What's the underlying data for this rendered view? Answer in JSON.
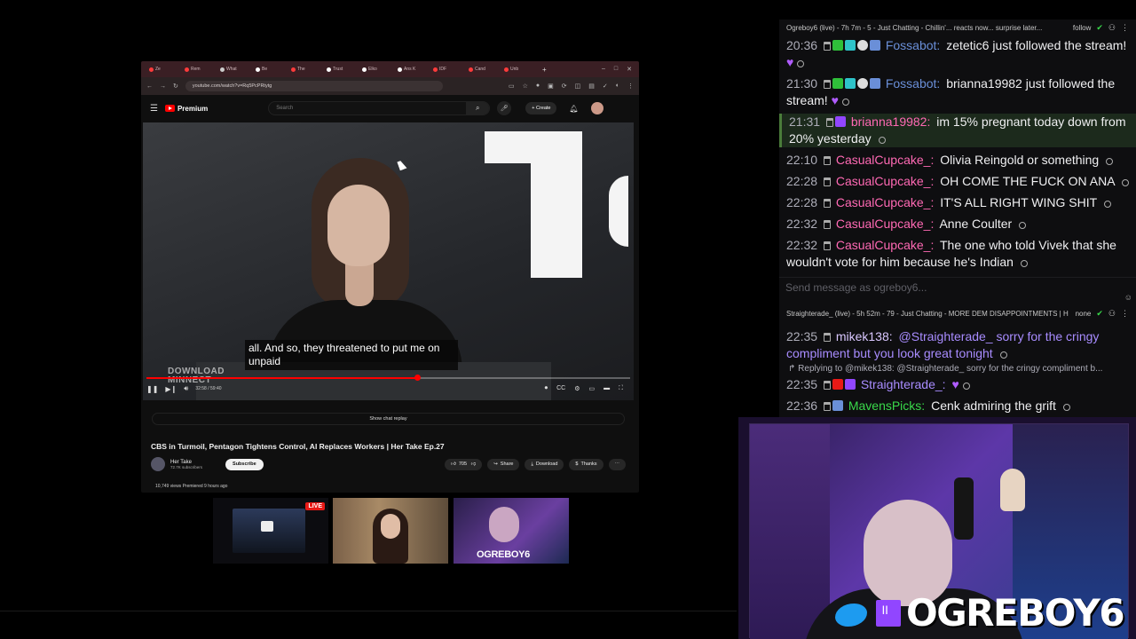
{
  "browser": {
    "tabs": [
      "Ze",
      "Rem",
      "What",
      "Be",
      "The",
      "Trust",
      "Elko",
      "Ans K",
      "IDF",
      "Cand",
      "Unb"
    ],
    "tab_colors": [
      "#ff3b3b",
      "#ff3b3b",
      "#cccccc",
      "#cccccc",
      "#ffffff",
      "#ff3b3b",
      "#ffffff",
      "#ffffff",
      "#ffffff",
      "#ff3b3b",
      "#ff3b3b",
      "#ff3b3b"
    ],
    "url": "youtube.com/watch?v=Rq5PcPRtytg"
  },
  "youtube": {
    "brand": "Premium",
    "search_placeholder": "Search",
    "create_label": "Create",
    "caption": "all. And so, they threatened to put me on unpaid",
    "watermark": "DOWNLOAD\nMINNECT",
    "timecode": "32:58 / 59:40",
    "progress_fraction": 0.56,
    "chat_replay": "Show chat replay",
    "title": "CBS in Turmoil, Pentagon Tightens Control, AI Replaces Workers | Her Take Ep.27",
    "channel_name": "Her Take",
    "channel_subs": "72.7K subscribers",
    "subscribe": "Subscribe",
    "likes": "705",
    "share": "Share",
    "download": "Download",
    "thanks": "Thanks",
    "meta": "10,749 views  Premiered 9 hours ago"
  },
  "thumbnails": {
    "live": "LIVE",
    "label3": "OGREBOY6"
  },
  "chat1": {
    "header": "Ogreboy6 (live) - 7h 7m - 5 - Just Chatting - Chillin'... reacts now... surprise later...",
    "follow": "follow",
    "messages": [
      {
        "time": "20:36",
        "user": "Fossabot:",
        "color": "#6a8fd8",
        "text": " zetetic6 just followed the stream!"
      },
      {
        "time": "21:30",
        "user": "Fossabot:",
        "color": "#6a8fd8",
        "text": " brianna19982 just followed the stream!"
      },
      {
        "time": "21:31",
        "user": "brianna19982:",
        "color": "#ff69b4",
        "text": " im 15% pregnant today down from 20% yesterday"
      },
      {
        "time": "22:10",
        "user": "CasualCupcake_:",
        "color": "#ff69b4",
        "text": " Olivia Reingold or something"
      },
      {
        "time": "22:28",
        "user": "CasualCupcake_:",
        "color": "#ff69b4",
        "text": " OH COME THE FUCK ON ANA"
      },
      {
        "time": "22:28",
        "user": "CasualCupcake_:",
        "color": "#ff69b4",
        "text": " IT'S ALL RIGHT WING SHIT"
      },
      {
        "time": "22:32",
        "user": "CasualCupcake_:",
        "color": "#ff69b4",
        "text": " Anne Coulter"
      },
      {
        "time": "22:32",
        "user": "CasualCupcake_:",
        "color": "#ff69b4",
        "text": " The one who told Vivek that she wouldn't vote for him because he's Indian"
      }
    ],
    "input_placeholder": "Send message as ogreboy6..."
  },
  "chat2": {
    "header": "Straighterade_ (live) - 5h 52m - 79 - Just Chatting - MORE DEM DISAPPOINTMENTS | H",
    "none": "none",
    "m1_time": "22:35",
    "m1_user": "mikek138:",
    "m1_text": " @Straighterade_ sorry for the cringy compliment but you look great tonight",
    "reply": "Replying to @mikek138: @Straighterade_ sorry for the cringy compliment b...",
    "m2_time": "22:35",
    "m2_user": "Straighterade_:",
    "m3_time": "22:36",
    "m3_user": "MavensPicks:",
    "m3_text": " Cenk admiring the grift"
  },
  "cam": {
    "name": "OGREBOY6"
  }
}
